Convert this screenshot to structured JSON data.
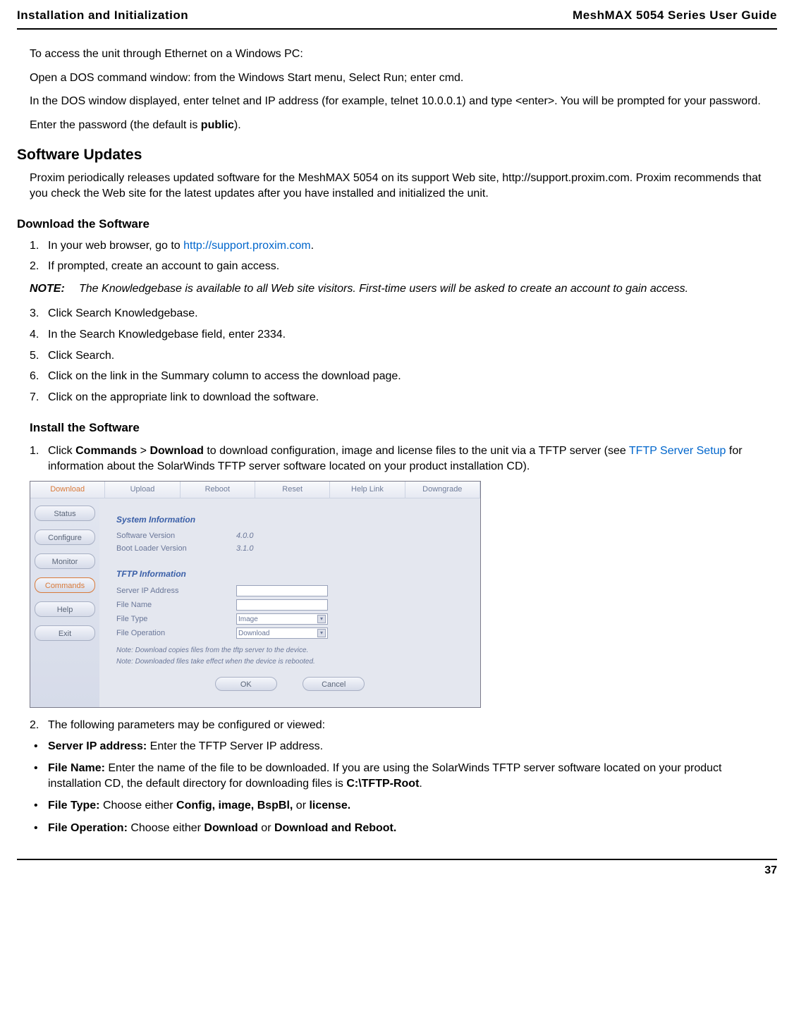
{
  "header": {
    "left": "Installation and Initialization",
    "right": "MeshMAX 5054 Series User Guide"
  },
  "intro": {
    "p1": "To access the unit through Ethernet on a Windows PC:",
    "p2": "Open a DOS command window: from the Windows Start menu, Select Run; enter cmd.",
    "p3": "In the DOS window displayed, enter telnet and IP address (for example, telnet 10.0.0.1) and type <enter>. You will be prompted for your password.",
    "p4_pre": "Enter the password (the default is ",
    "p4_bold": "public",
    "p4_post": ")."
  },
  "software_updates": {
    "heading": "Software Updates",
    "para": "Proxim periodically releases updated software for the MeshMAX 5054 on its support Web site, http://support.proxim.com. Proxim recommends that you check the Web site for the latest updates after you have installed and initialized the unit."
  },
  "download": {
    "heading": "Download the Software",
    "step1_pre": "In your web browser, go to ",
    "step1_link": "http://support.proxim.com",
    "step1_post": ".",
    "step2": "If prompted, create an account to gain access.",
    "note_label": "NOTE:",
    "note_text": "The Knowledgebase is available to all Web site visitors. First-time users will be asked to create an account to gain access.",
    "step3": "Click Search Knowledgebase.",
    "step4": "In the Search Knowledgebase field, enter 2334.",
    "step5": "Click Search.",
    "step6": "Click on the link in the Summary column to access the download page.",
    "step7": "Click on the appropriate link to download the software."
  },
  "install": {
    "heading": "Install the Software",
    "step1_pre": "Click ",
    "step1_b1": "Commands",
    "step1_mid1": " > ",
    "step1_b2": "Download",
    "step1_mid2": " to download configuration, image and license files to the unit via a TFTP server (see ",
    "step1_link": "TFTP Server Setup",
    "step1_post": " for information about the SolarWinds TFTP server software located on your product installation CD).",
    "step2": "The following parameters may be configured or viewed:",
    "bullets": {
      "b1_label": "Server IP address:",
      "b1_text": " Enter the TFTP Server IP address.",
      "b2_label": "File Name:",
      "b2_text_pre": " Enter the name of the file to be downloaded. If you are using the SolarWinds TFTP server software located on your product installation CD, the default directory for downloading files is ",
      "b2_bold": "C:\\TFTP-Root",
      "b2_post": ".",
      "b3_label": "File Type:",
      "b3_text_pre": " Choose either ",
      "b3_bold": "Config, image, BspBl,",
      "b3_text_mid": " or ",
      "b3_bold2": "license.",
      "b4_label": "File Operation:",
      "b4_text_pre": " Choose either ",
      "b4_bold1": "Download",
      "b4_text_mid": " or ",
      "b4_bold2": "Download and Reboot."
    }
  },
  "ui": {
    "tabs": [
      "Download",
      "Upload",
      "Reboot",
      "Reset",
      "Help Link",
      "Downgrade"
    ],
    "sidebar": [
      "Status",
      "Configure",
      "Monitor",
      "Commands",
      "Help",
      "Exit"
    ],
    "groups": {
      "sysinfo_title": "System Information",
      "sw_ver_label": "Software Version",
      "sw_ver_val": "4.0.0",
      "bl_ver_label": "Boot Loader Version",
      "bl_ver_val": "3.1.0",
      "tftp_title": "TFTP Information",
      "server_ip": "Server IP Address",
      "file_name": "File Name",
      "file_type": "File Type",
      "file_type_val": "Image",
      "file_op": "File Operation",
      "file_op_val": "Download",
      "note1": "Note: Download copies files from the tftp server to the device.",
      "note2": "Note: Downloaded files take effect when the device is rebooted.",
      "ok": "OK",
      "cancel": "Cancel"
    }
  },
  "page_number": "37"
}
